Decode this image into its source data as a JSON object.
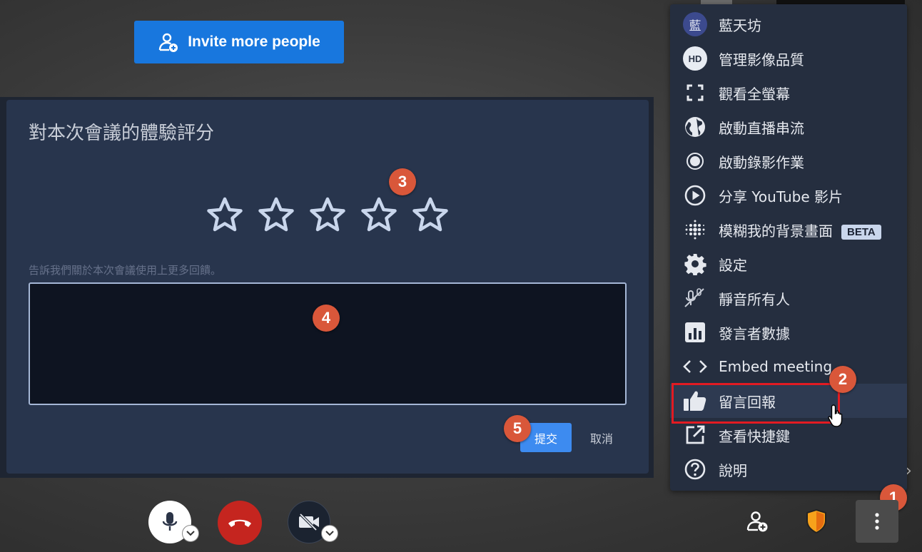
{
  "invite": {
    "label": "Invite more people"
  },
  "dialog": {
    "title": "對本次會議的體驗評分",
    "feedback_label": "告訴我們關於本次會議使用上更多回饋。",
    "feedback_value": "",
    "submit_label": "提交",
    "cancel_label": "取消",
    "rating": 0,
    "max_rating": 5
  },
  "menu": {
    "items": [
      {
        "label": "藍天坊",
        "icon": "avatar",
        "avatar_text": "藍"
      },
      {
        "label": "管理影像品質",
        "icon": "hd-icon",
        "icon_text": "HD"
      },
      {
        "label": "觀看全螢幕",
        "icon": "fullscreen-icon"
      },
      {
        "label": "啟動直播串流",
        "icon": "globe-icon"
      },
      {
        "label": "啟動錄影作業",
        "icon": "record-icon"
      },
      {
        "label": "分享 YouTube 影片",
        "icon": "play-icon"
      },
      {
        "label": "模糊我的背景畫面",
        "icon": "blur-icon",
        "tag": "BETA"
      },
      {
        "label": "設定",
        "icon": "gear-icon"
      },
      {
        "label": "靜音所有人",
        "icon": "mute-all-icon"
      },
      {
        "label": "發言者數據",
        "icon": "stats-icon"
      },
      {
        "label": "Embed meeting",
        "icon": "embed-icon"
      },
      {
        "label": "留言回報",
        "icon": "thumbs-up-icon"
      },
      {
        "label": "查看快捷鍵",
        "icon": "external-link-icon"
      },
      {
        "label": "說明",
        "icon": "help-icon"
      }
    ]
  },
  "badges": {
    "b1": "1",
    "b2": "2",
    "b3": "3",
    "b4": "4",
    "b5": "5"
  },
  "colors": {
    "accent": "#1877de",
    "highlight": "#e21b22",
    "badge": "#d9573a",
    "hangup": "#c5251f"
  }
}
